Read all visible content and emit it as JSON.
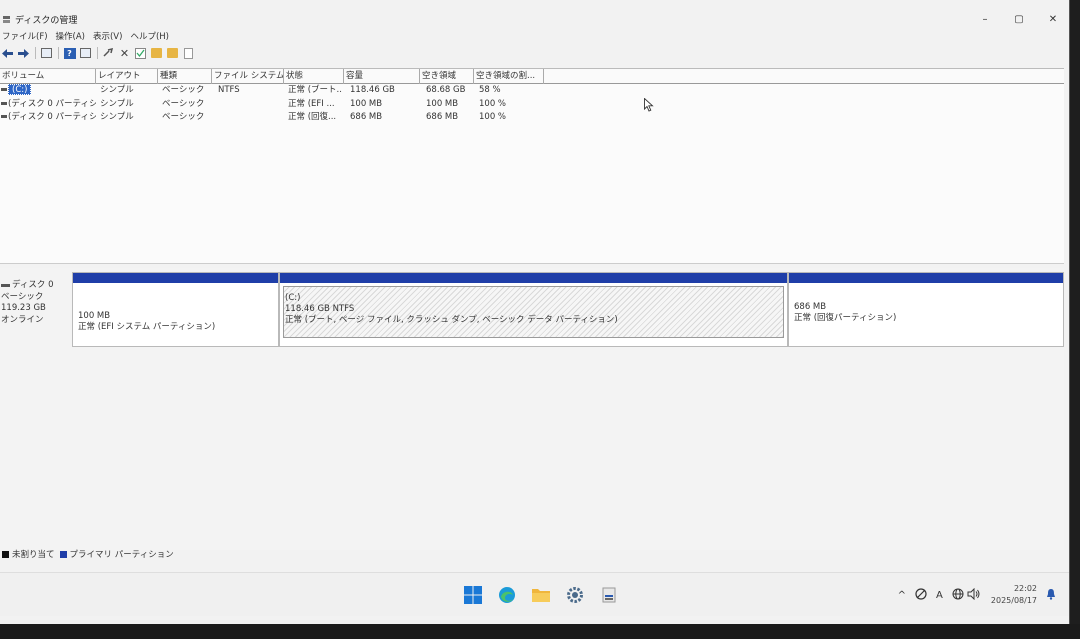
{
  "window": {
    "title": "ディスクの管理",
    "minimize": "–",
    "maximize": "▢",
    "close": "✕"
  },
  "menu": [
    "ファイル(F)",
    "操作(A)",
    "表示(V)",
    "ヘルプ(H)"
  ],
  "volume_table": {
    "columns": [
      "ボリューム",
      "レイアウト",
      "種類",
      "ファイル システム",
      "状態",
      "容量",
      "空き領域",
      "空き領域の割..."
    ],
    "rows": [
      {
        "volume": "(C:)",
        "layout": "シンプル",
        "type": "ベーシック",
        "fs": "NTFS",
        "status": "正常 (ブート...",
        "capacity": "118.46 GB",
        "free": "68.68 GB",
        "pct": "58 %",
        "selected": true
      },
      {
        "volume": "(ディスク 0 パーティシ...",
        "layout": "シンプル",
        "type": "ベーシック",
        "fs": "",
        "status": "正常 (EFI ...",
        "capacity": "100 MB",
        "free": "100 MB",
        "pct": "100 %",
        "selected": false
      },
      {
        "volume": "(ディスク 0 パーティシ...",
        "layout": "シンプル",
        "type": "ベーシック",
        "fs": "",
        "status": "正常 (回復...",
        "capacity": "686 MB",
        "free": "686 MB",
        "pct": "100 %",
        "selected": false
      }
    ]
  },
  "disk": {
    "name": "ディスク 0",
    "type": "ベーシック",
    "size": "119.23 GB",
    "state": "オンライン",
    "partitions": [
      {
        "line1": "",
        "line2": "100 MB",
        "line3": "正常 (EFI システム パーティション)"
      },
      {
        "line1": "(C:)",
        "line2": "118.46 GB NTFS",
        "line3": "正常 (ブート, ページ ファイル, クラッシュ ダンプ, ベーシック データ パーティション)"
      },
      {
        "line1": "",
        "line2": "686 MB",
        "line3": "正常 (回復パーティション)"
      }
    ]
  },
  "legend": [
    {
      "label": "未割り当て",
      "color": "#111111"
    },
    {
      "label": "プライマリ パーティション",
      "color": "#1f3ea8"
    }
  ],
  "colors": {
    "partition_bar": "#1f3ea8",
    "selection": "#2e66c6"
  },
  "taskbar": {
    "icons": [
      "windows-start-icon",
      "edge-icon",
      "file-explorer-icon",
      "settings-icon",
      "disk-management-icon"
    ],
    "tray": {
      "time": "22:02",
      "date": "2025/08/17",
      "ime": "A"
    }
  }
}
